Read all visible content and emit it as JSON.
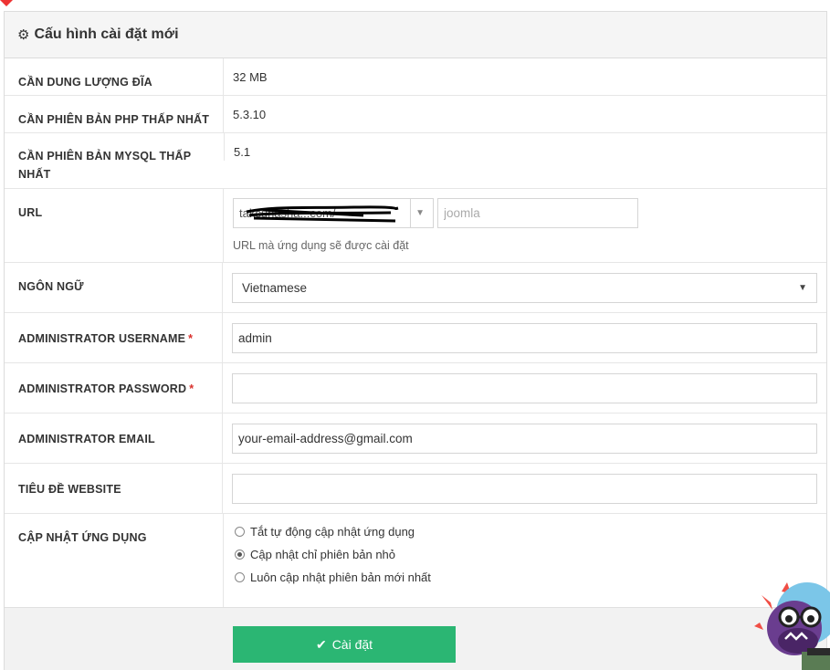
{
  "panel": {
    "title": "Cấu hình cài đặt mới",
    "header_icon": "gears-icon"
  },
  "requirements": [
    {
      "label": "CẦN DUNG LƯỢNG ĐĨA",
      "value": "32 MB"
    },
    {
      "label": "CẦN PHIÊN BẢN PHP THẤP NHẤT",
      "value": "5.3.10"
    },
    {
      "label": "CẦN PHIÊN BẢN MYSQL THẤP NHẤT",
      "value": "5.1"
    }
  ],
  "url": {
    "label": "URL",
    "domain_value": "takcunasha...com/",
    "path_placeholder": "joomla",
    "help": "URL mà ứng dụng sẽ được cài đặt"
  },
  "language": {
    "label": "NGÔN NGỮ",
    "value": "Vietnamese"
  },
  "admin_username": {
    "label": "ADMINISTRATOR USERNAME",
    "value": "admin",
    "required": "*"
  },
  "admin_password": {
    "label": "ADMINISTRATOR PASSWORD",
    "value": "",
    "required": "*"
  },
  "admin_email": {
    "label": "ADMINISTRATOR EMAIL",
    "value": "your-email-address@gmail.com"
  },
  "site_title": {
    "label": "TIÊU ĐỀ WEBSITE",
    "value": ""
  },
  "update": {
    "label": "CẬP NHẬT ỨNG DỤNG",
    "options": [
      {
        "label": "Tắt tự động cập nhật ứng dụng",
        "checked": false
      },
      {
        "label": "Cập nhật chỉ phiên bản nhỏ",
        "checked": true
      },
      {
        "label": "Luôn cập nhật phiên bản mới nhất",
        "checked": false
      }
    ]
  },
  "install_button": {
    "label": "Cài đặt",
    "icon": "check-icon",
    "color": "#2bb673"
  }
}
